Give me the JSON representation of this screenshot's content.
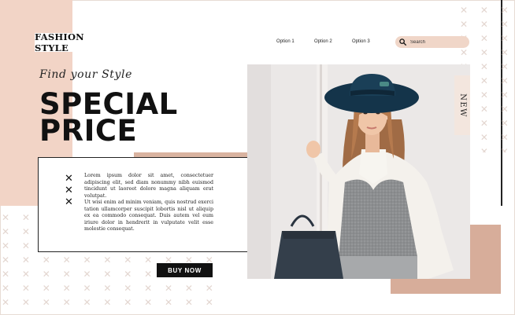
{
  "header": {
    "logo": "FASHION STYLE",
    "nav": [
      "Option 1",
      "Option 2",
      "Option 3"
    ],
    "search_placeholder": "Search"
  },
  "hero": {
    "tagline": "Find your Style",
    "headline_line1": "SPECIAL",
    "headline_line2": "PRICE",
    "paragraph1": "Lorem ipsum dolor sit amet, consectetuer adipiscing elit, sed diam nonummy nibh euismod tincidunt ut laoreet dolore magna aliquam erat volutpat.",
    "paragraph2": "Ut wisi enim ad minim veniam, quis nostrud exerci tation ullamcorper suscipit lobortis nisl ut aliquip ex ea commodo consequat. Duis autem vel eum iriure dolor in hendrerit in vulputate velit esse molestie consequat.",
    "cta": "BUY NOW"
  },
  "badge": "NEW",
  "colors": {
    "peach_light": "#f2d4c6",
    "peach_dark": "#d7ad9a",
    "ink": "#111111"
  }
}
